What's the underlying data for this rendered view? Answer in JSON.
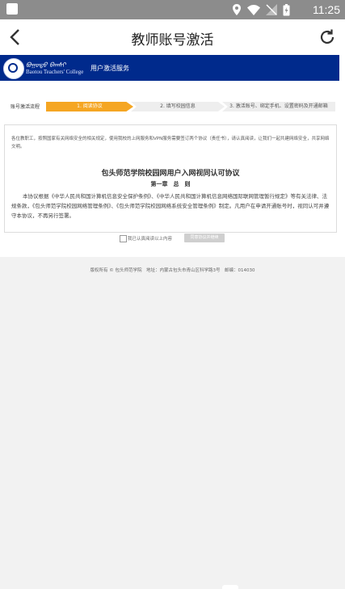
{
  "status_bar": {
    "time": "11:25",
    "icons": [
      "location-icon",
      "wifi-icon",
      "signal-off-icon",
      "battery-charging-icon"
    ]
  },
  "app_bar": {
    "title": "教师账号激活",
    "back_icon": "chevron-left-icon",
    "refresh_icon": "refresh-icon"
  },
  "banner": {
    "logo_script": "ᠪᠣᠭᠣᠲᠣ ᠪᠠᠭᠰᠢ",
    "logo_english": "Baotou Teachers' College",
    "service_label": "用户激活服务",
    "color": "#002a8c"
  },
  "steps": {
    "label": "账号激活流程",
    "items": [
      {
        "label": "1. 阅读协议",
        "active": true
      },
      {
        "label": "2. 填写校园信息",
        "active": false
      },
      {
        "label": "3. 激活账号、绑定手机、设置密码及开通邮箱",
        "active": false
      }
    ],
    "active_color": "#f5a623"
  },
  "document": {
    "notice": "各位教职工，按照国家有关网络安全的相关规定，使用我校的上网服务和VPN服务需要签订两个协议（责任书），请认真阅读，让我们一起共建网络安全，共享网络文明。",
    "title": "包头师范学院校园网用户入网视同认可协议",
    "chapter": "第一章　总　则",
    "body": "本协议根据《中华人民共和国计算机信息安全保护条例》、《中华人民共和国计算机信息网络国际联网管理暂行规定》等有关法律、法规条款，《包头师范学院校园网络管理条例》、《包头师范学院校园网络系统安全管理条例》制定。凡用户在申请开通账号时，视同认可并遵守本协议，不再另行签署。"
  },
  "agreement": {
    "checkbox_label": "我已认真阅读以上内容",
    "button_label": "同意协议并继续"
  },
  "footer": {
    "text": "版权所有 © 包头师范学院　地址：内蒙古包头市青山区科学路3号　邮编：014030"
  }
}
